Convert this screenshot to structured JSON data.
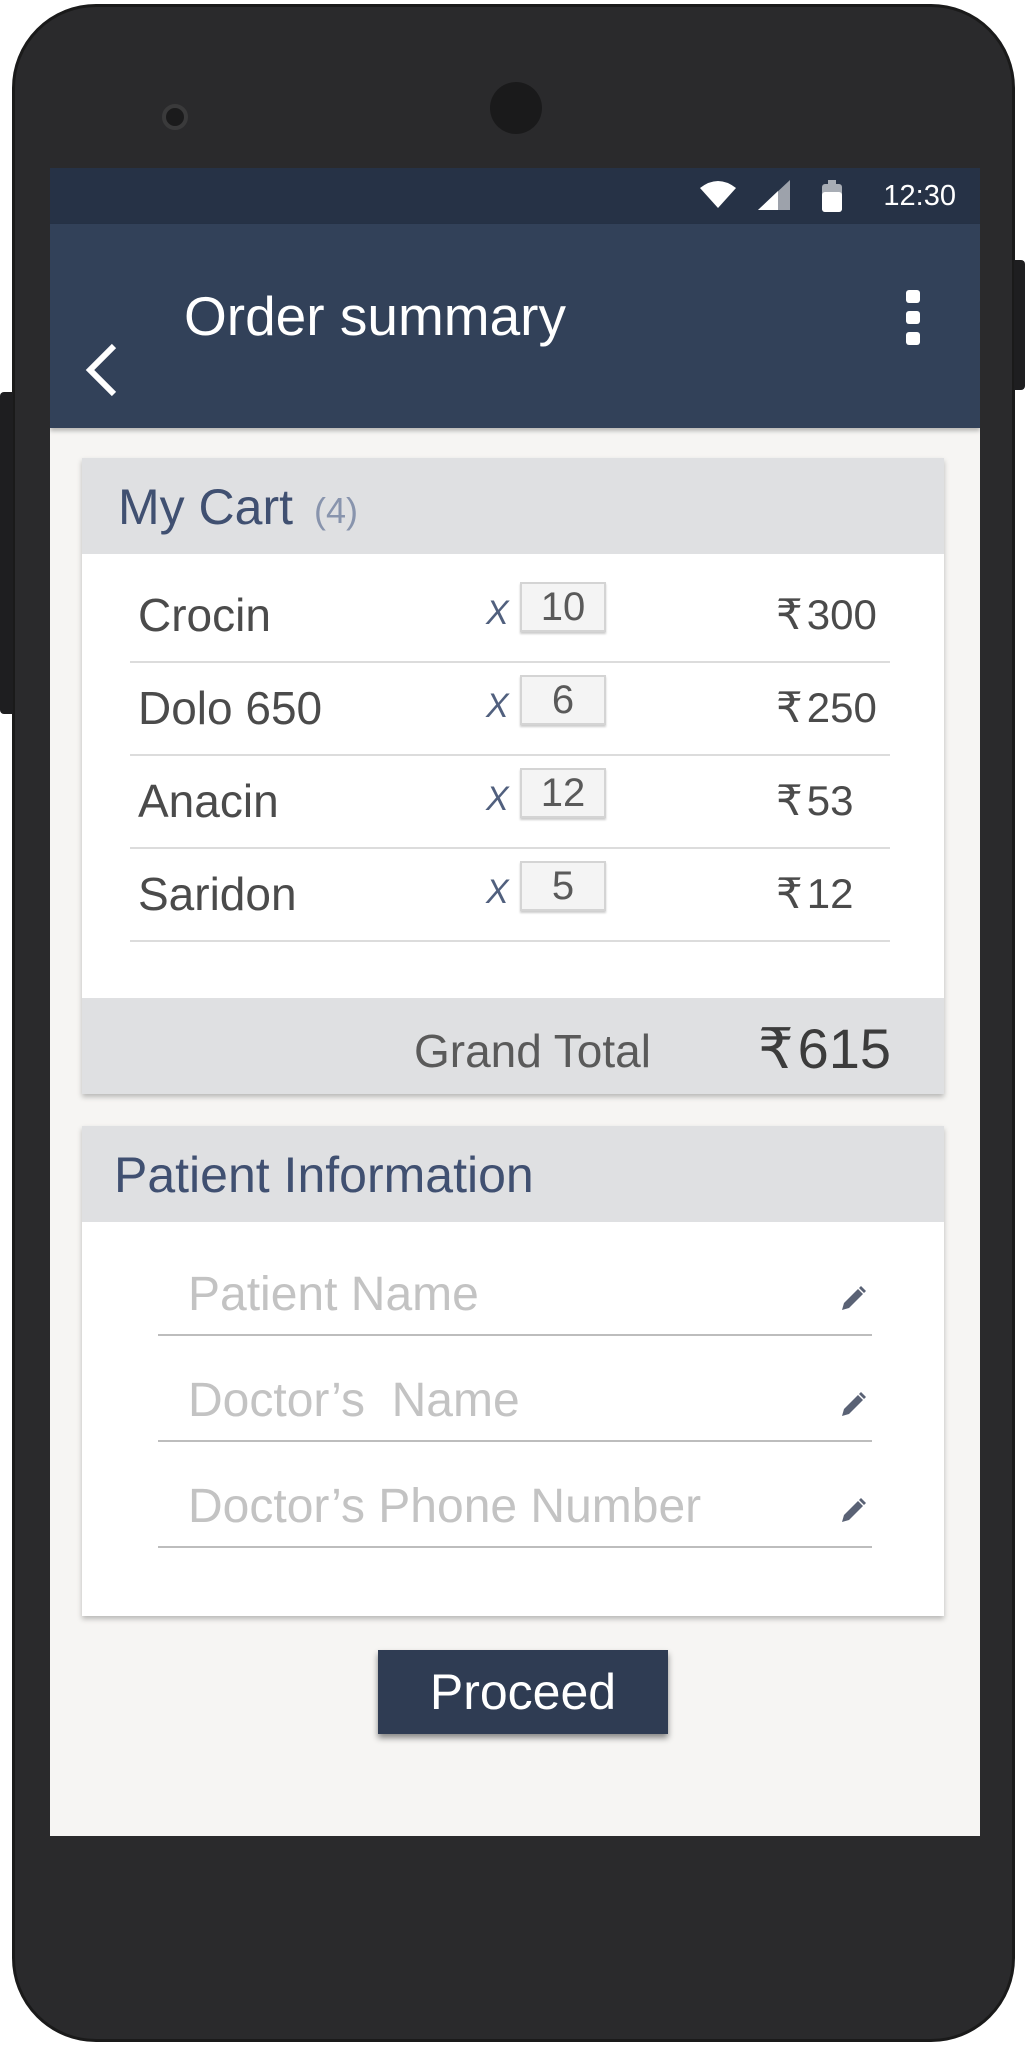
{
  "status_bar": {
    "time": "12:30",
    "icons": [
      "wifi-icon",
      "cellular-signal-icon",
      "battery-icon"
    ]
  },
  "app_bar": {
    "title": "Order summary",
    "back_icon": "chevron-left-icon",
    "menu_icon": "more-vertical-icon"
  },
  "cart": {
    "title": "My Cart",
    "count": "(4)",
    "items": [
      {
        "name": "Crocin",
        "times": "X",
        "qty": "10",
        "currency": "₹",
        "price": "300"
      },
      {
        "name": "Dolo 650",
        "times": "X",
        "qty": "6",
        "currency": "₹",
        "price": "250"
      },
      {
        "name": "Anacin",
        "times": "X",
        "qty": "12",
        "currency": "₹",
        "price": "53"
      },
      {
        "name": "Saridon",
        "times": "X",
        "qty": "5",
        "currency": "₹",
        "price": "12"
      }
    ],
    "grand_total_label": "Grand Total",
    "grand_total_currency": "₹",
    "grand_total_value": "615"
  },
  "patient": {
    "title": "Patient Information",
    "fields": [
      {
        "placeholder": "Patient Name",
        "value": "",
        "icon": "pencil-icon"
      },
      {
        "placeholder": "Doctor’s  Name",
        "value": "",
        "icon": "pencil-icon"
      },
      {
        "placeholder": "Doctor’s Phone Number",
        "value": "",
        "icon": "pencil-icon"
      }
    ]
  },
  "proceed_label": "Proceed",
  "colors": {
    "status_bar": "#263246",
    "app_bar": "#324159",
    "accent_text": "#405071",
    "button": "#2f3c53",
    "screen_bg": "#f6f5f3"
  }
}
